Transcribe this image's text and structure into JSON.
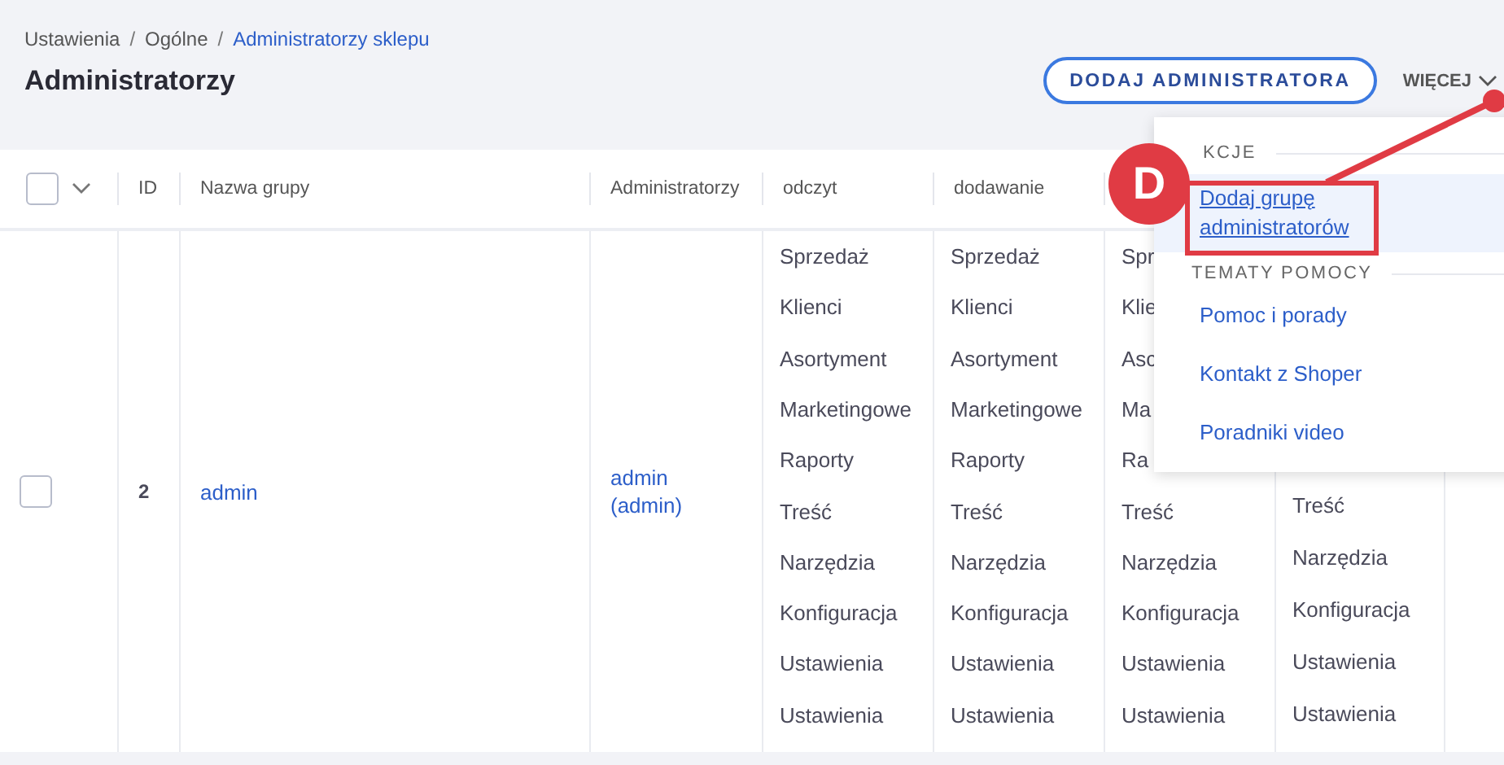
{
  "breadcrumb": [
    {
      "label": "Ustawienia",
      "current": false
    },
    {
      "label": "Ogólne",
      "current": false
    },
    {
      "label": "Administratorzy sklepu",
      "current": true
    }
  ],
  "breadcrumb_separator": "/",
  "title": "Administratorzy",
  "add_button": "DODAJ ADMINISTRATORA",
  "more_button": {
    "label": "WIĘCEJ",
    "expanded": true
  },
  "table": {
    "select_all": {
      "checked": false
    },
    "columns": [
      "ID",
      "Nazwa grupy",
      "Administratorzy"
    ],
    "permission_columns": [
      {
        "header": "odczyt"
      },
      {
        "header": "dodawanie"
      },
      {},
      {}
    ],
    "rows": [
      {
        "selected": false,
        "id": "2",
        "name": "admin",
        "admins": "admin (admin)",
        "permissions": [
          [
            "Sprzedaż",
            "Klienci",
            "Asortyment",
            "Marketingowe",
            "Raporty",
            "Treść",
            "Narzędzia",
            "Konfiguracja",
            "Ustawienia",
            "Ustawienia"
          ],
          [
            "Sprzedaż",
            "Klienci",
            "Asortyment",
            "Marketingowe",
            "Raporty",
            "Treść",
            "Narzędzia",
            "Konfiguracja",
            "Ustawienia",
            "Ustawienia"
          ],
          [
            "Spr",
            "Klie",
            "Asc",
            "Ma",
            "Ra",
            "Treść",
            "Narzędzia",
            "Konfiguracja",
            "Ustawienia",
            "Ustawienia"
          ],
          [
            "Treść",
            "Narzędzia",
            "Konfiguracja",
            "Ustawienia",
            "Ustawienia"
          ]
        ]
      }
    ]
  },
  "menu": {
    "sections": [
      {
        "title": "KCJE",
        "items": [
          {
            "label": "Dodaj grupę administratorów",
            "selected": true
          }
        ]
      },
      {
        "title": "TEMATY POMOCY",
        "items": [
          {
            "label": "Pomoc i porady",
            "selected": false
          },
          {
            "label": "Kontakt z Shoper",
            "selected": false
          },
          {
            "label": "Poradniki video",
            "selected": false
          }
        ]
      }
    ]
  },
  "annotation": {
    "label": "D"
  }
}
